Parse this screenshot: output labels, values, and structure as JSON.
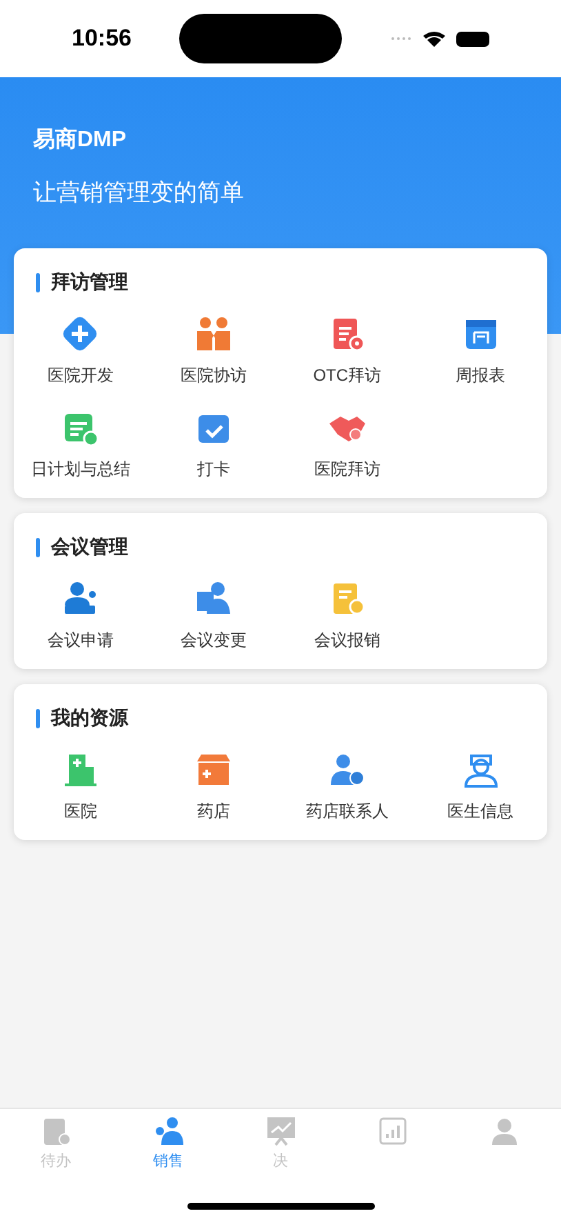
{
  "status_bar": {
    "time": "10:56"
  },
  "header": {
    "title": "易商DMP",
    "subtitle": "让营销管理变的简单"
  },
  "sections": [
    {
      "title": "拜访管理",
      "items": [
        "医院开发",
        "医院协访",
        "OTC拜访",
        "周报表",
        "日计划与总结",
        "打卡",
        "医院拜访"
      ]
    },
    {
      "title": "会议管理",
      "items": [
        "会议申请",
        "会议变更",
        "会议报销"
      ]
    },
    {
      "title": "我的资源",
      "items": [
        "医院",
        "药店",
        "药店联系人",
        "医生信息"
      ]
    }
  ],
  "tab_bar": [
    {
      "label": "待办",
      "selected": false
    },
    {
      "label": "销售",
      "selected": true
    },
    {
      "label": "决",
      "selected": false
    },
    {
      "selected": false
    },
    {
      "selected": false
    }
  ]
}
